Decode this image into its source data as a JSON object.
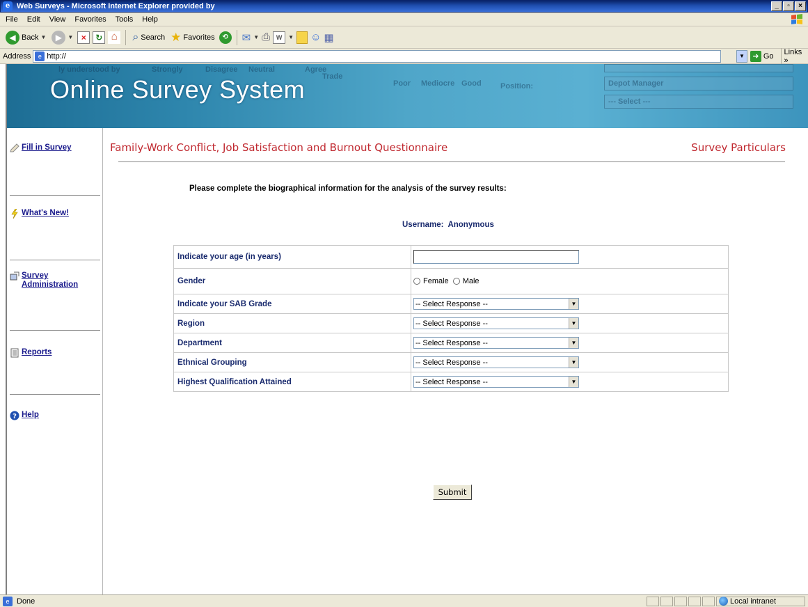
{
  "window": {
    "title": "Web Surveys - Microsoft Internet Explorer provided by"
  },
  "menu": [
    "File",
    "Edit",
    "View",
    "Favorites",
    "Tools",
    "Help"
  ],
  "toolbar": {
    "back_label": "Back",
    "search_label": "Search",
    "favorites_label": "Favorites"
  },
  "address": {
    "label": "Address",
    "url": "http://",
    "go_label": "Go",
    "links_label": "Links"
  },
  "banner": {
    "title": "Online Survey System",
    "ghost": [
      "ly understood by",
      "Strongly",
      "Disagree",
      "Neutral",
      "Agree",
      "Trade",
      "Poor",
      "Mediocre",
      "Good",
      "Position:",
      "Depot Manager",
      "--- Select ---"
    ]
  },
  "sidebar": {
    "items": [
      {
        "label": "Fill in Survey",
        "icon": "pencil-icon"
      },
      {
        "label": "What's New!",
        "icon": "lightning-icon"
      },
      {
        "label": "Survey Administration",
        "icon": "admin-icon"
      },
      {
        "label": "Reports",
        "icon": "report-icon"
      },
      {
        "label": "Help",
        "icon": "help-icon"
      }
    ]
  },
  "main": {
    "survey_title": "Family-Work Conflict, Job Satisfaction and Burnout Questionnaire",
    "survey_particulars": "Survey Particulars",
    "instructions": "Please complete the biographical information for the analysis of the survey results:",
    "username_label": "Username:",
    "username_value": "Anonymous",
    "questions": {
      "age": "Indicate your age (in years)",
      "gender": "Gender",
      "sab_grade": "Indicate your SAB Grade",
      "region": "Region",
      "department": "Department",
      "ethnical": "Ethnical Grouping",
      "qualification": "Highest Qualification Attained"
    },
    "gender_options": [
      "Female",
      "Male"
    ],
    "select_placeholder": "-- Select Response --",
    "submit_label": "Submit"
  },
  "status": {
    "text": "Done",
    "zone": "Local intranet"
  }
}
